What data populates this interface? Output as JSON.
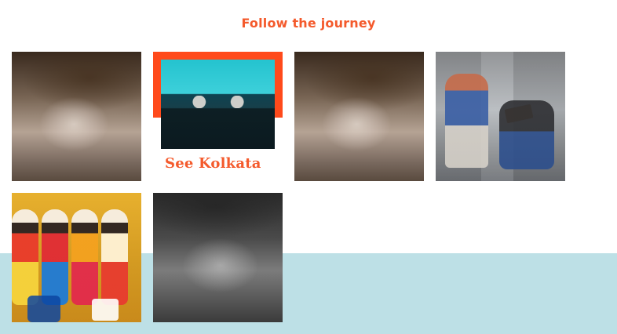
{
  "header": {
    "title": "Follow the journey"
  },
  "gallery": {
    "featured_caption": "See Kolkata"
  },
  "theme": {
    "accent": "#f45a2c",
    "band": "#bde0e6",
    "feature_frame": "#ff4a1b"
  }
}
